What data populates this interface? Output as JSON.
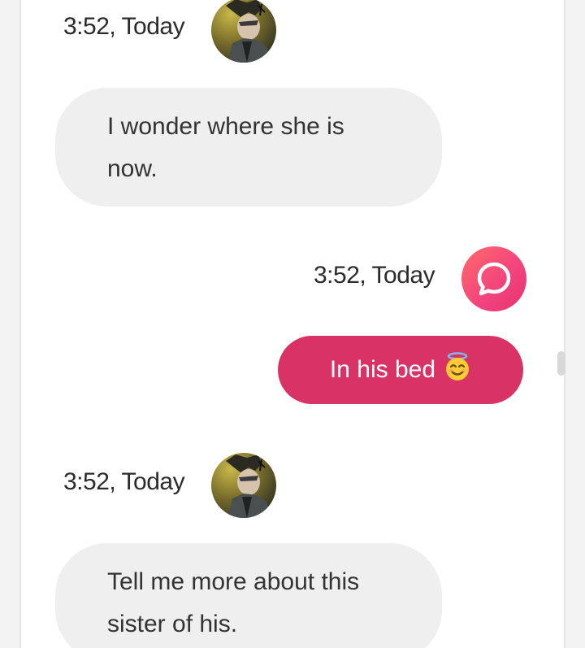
{
  "messages": [
    {
      "sender": "character",
      "time": "3:52, Today",
      "avatar_icon": "character-avatar-icon",
      "text": "I wonder where she is now."
    },
    {
      "sender": "user",
      "time": "3:52, Today",
      "avatar_icon": "chat-bubble-icon",
      "text": "In his bed",
      "emoji": "😇"
    },
    {
      "sender": "character",
      "time": "3:52, Today",
      "avatar_icon": "character-avatar-icon",
      "text": "Tell me more about this sister of his."
    }
  ],
  "colors": {
    "incoming_bubble": "#efefef",
    "outgoing_bubble": "#d93366",
    "bot_avatar_gradient_start": "#ff6a6a",
    "bot_avatar_gradient_end": "#e5336f"
  }
}
